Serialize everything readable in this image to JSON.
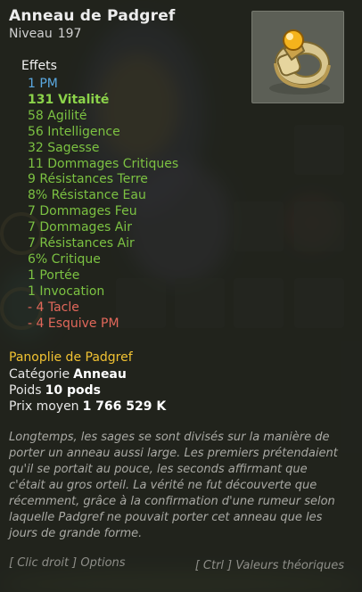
{
  "item": {
    "name": "Anneau de Padgref",
    "level_label": "Niveau",
    "level": "197"
  },
  "effects": {
    "title": "Effets",
    "list": [
      {
        "text": "1 PM",
        "color": "#5aa8e0",
        "bold": false
      },
      {
        "text": "131 Vitalité",
        "color": "#8bd24a",
        "bold": true
      },
      {
        "text": "58 Agilité",
        "color": "#7cc242",
        "bold": false
      },
      {
        "text": "56 Intelligence",
        "color": "#7cc242",
        "bold": false
      },
      {
        "text": "32 Sagesse",
        "color": "#7cc242",
        "bold": false
      },
      {
        "text": "11 Dommages Critiques",
        "color": "#7cc242",
        "bold": false
      },
      {
        "text": "9 Résistances Terre",
        "color": "#7cc242",
        "bold": false
      },
      {
        "text": "8% Résistance Eau",
        "color": "#7cc242",
        "bold": false
      },
      {
        "text": "7 Dommages Feu",
        "color": "#7cc242",
        "bold": false
      },
      {
        "text": "7 Dommages Air",
        "color": "#7cc242",
        "bold": false
      },
      {
        "text": "7 Résistances Air",
        "color": "#7cc242",
        "bold": false
      },
      {
        "text": "6% Critique",
        "color": "#7cc242",
        "bold": false
      },
      {
        "text": "1 Portée",
        "color": "#7cc242",
        "bold": false
      },
      {
        "text": "1 Invocation",
        "color": "#7cc242",
        "bold": false
      },
      {
        "text": "- 4 Tacle",
        "color": "#e2685b",
        "bold": false
      },
      {
        "text": "- 4 Esquive PM",
        "color": "#e2685b",
        "bold": false
      }
    ]
  },
  "set": {
    "name": "Panoplie de Padgref",
    "color": "#f1c232"
  },
  "properties": {
    "category_label": "Catégorie",
    "category_value": "Anneau",
    "weight_label": "Poids",
    "weight_value": "10 pods",
    "price_label": "Prix moyen",
    "price_value": "1 766 529 K"
  },
  "description": "Longtemps, les sages se sont divisés sur la manière de porter un anneau aussi large. Les premiers prétendaient qu'il se portait au pouce, les seconds affirmant que c'était au gros orteil. La vérité ne fut découverte que récemment, grâce à la confirmation d'une rumeur selon laquelle Padgref ne pouvait porter cet anneau que les jours de grande forme.",
  "footer": {
    "left": "[ Clic droit ] Options",
    "right": "[ Ctrl ] Valeurs théoriques"
  },
  "icons": {
    "item": "gold-ring-with-gem-icon"
  }
}
